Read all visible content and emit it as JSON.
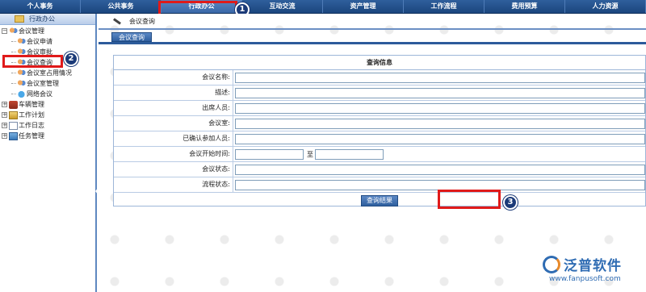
{
  "topnav": {
    "items": [
      {
        "label": "个人事务"
      },
      {
        "label": "公共事务"
      },
      {
        "label": "行政办公"
      },
      {
        "label": "互动交流"
      },
      {
        "label": "资产管理"
      },
      {
        "label": "工作流程"
      },
      {
        "label": "费用预算"
      },
      {
        "label": "人力资源"
      }
    ],
    "active_index": 2
  },
  "sidebar": {
    "header": "行政办公",
    "tree": [
      {
        "label": "会议管理",
        "expander": "⊟",
        "icon": "users-icon"
      },
      {
        "label": "会议申请",
        "icon": "users-icon"
      },
      {
        "label": "会议审批",
        "icon": "users-icon"
      },
      {
        "label": "会议查询",
        "icon": "users-icon"
      },
      {
        "label": "会议室占用情况",
        "icon": "users-icon"
      },
      {
        "label": "会议室管理",
        "icon": "users-icon"
      },
      {
        "label": "网络会议",
        "icon": "network-icon"
      },
      {
        "label": "车辆管理",
        "expander": "⊞",
        "icon": "car-icon"
      },
      {
        "label": "工作计划",
        "expander": "⊞",
        "icon": "plan-icon"
      },
      {
        "label": "工作日志",
        "expander": "⊞",
        "icon": "log-icon"
      },
      {
        "label": "任务管理",
        "expander": "⊞",
        "icon": "task-icon"
      }
    ]
  },
  "main": {
    "breadcrumb": "会议查询",
    "tab": "会议查询",
    "form": {
      "title": "查询信息",
      "fields": [
        {
          "label": "会议名称:",
          "value": ""
        },
        {
          "label": "描述:",
          "value": ""
        },
        {
          "label": "出席人员:",
          "value": ""
        },
        {
          "label": "会议室:",
          "value": ""
        },
        {
          "label": "已确认参加人员:",
          "value": ""
        },
        {
          "label": "会议开始时间:",
          "from": "",
          "to_label": "至",
          "to": ""
        },
        {
          "label": "会议状态:",
          "value": ""
        },
        {
          "label": "流程状态:",
          "value": ""
        }
      ],
      "submit_label": "查询结果"
    }
  },
  "annotations": {
    "badges": [
      "1",
      "2",
      "3"
    ],
    "highlight_color": "#e01a1a"
  },
  "logo": {
    "brand": "泛普软件",
    "url": "www.fanpusoft.com"
  },
  "colors": {
    "nav_bg": "#1b467e",
    "accent": "#2c5b9b"
  }
}
